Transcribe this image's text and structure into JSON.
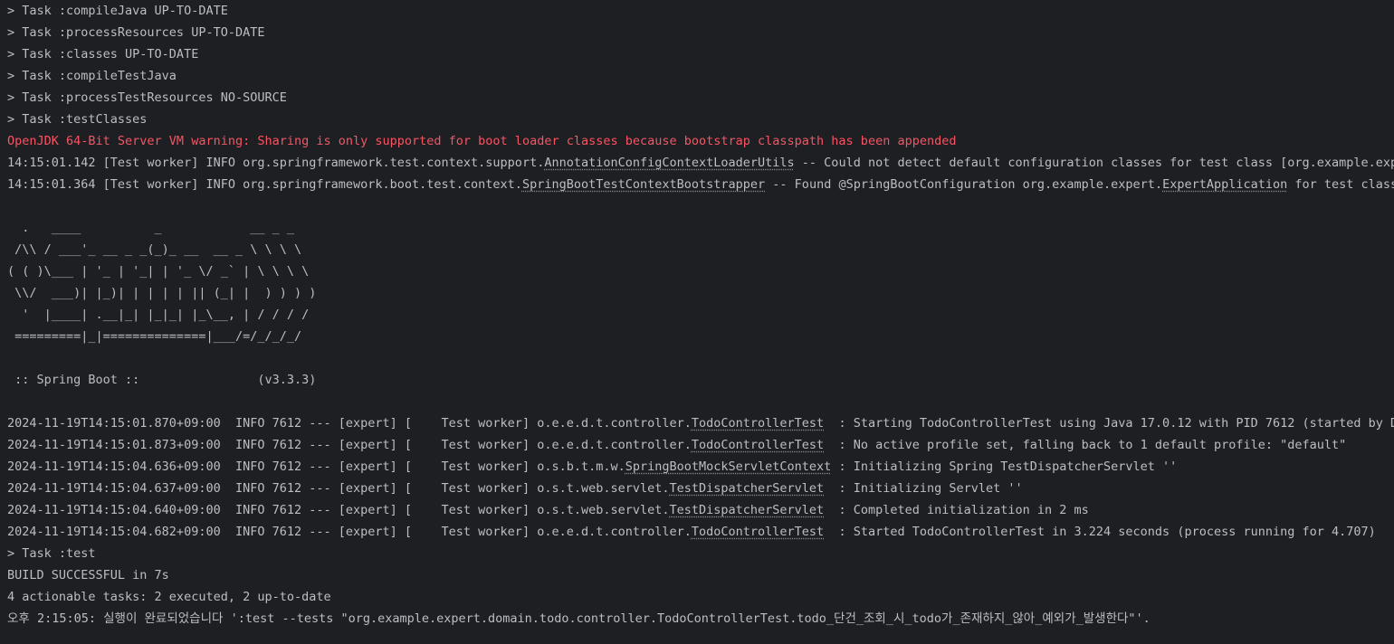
{
  "colors": {
    "background": "#1e1f22",
    "text": "#bcbec4",
    "warning": "#f75464"
  },
  "console": {
    "tasks": [
      "> Task :compileJava UP-TO-DATE",
      "> Task :processResources UP-TO-DATE",
      "> Task :classes UP-TO-DATE",
      "> Task :compileTestJava",
      "> Task :processTestResources NO-SOURCE",
      "> Task :testClasses"
    ],
    "warning": "OpenJDK 64-Bit Server VM warning: Sharing is only supported for boot loader classes because bootstrap classpath has been appended",
    "ctx1": {
      "pre": "14:15:01.142 [Test worker] INFO org.springframework.test.context.support.",
      "link": "AnnotationConfigContextLoaderUtils",
      "post": " -- Could not detect default configuration classes for test class [org.example.expert.domain.todo.controller.TodoControllerTest]"
    },
    "ctx2": {
      "pre": "14:15:01.364 [Test worker] INFO org.springframework.boot.test.context.",
      "link": "SpringBootTestContextBootstrapper",
      "mid": " -- Found @SpringBootConfiguration org.example.expert.",
      "link2": "ExpertApplication",
      "post": " for test class org.example.expert.domain.todo.controller.TodoControllerTest"
    },
    "banner": [
      "  .   ____          _            __ _ _",
      " /\\\\ / ___'_ __ _ _(_)_ __  __ _ \\ \\ \\ \\",
      "( ( )\\___ | '_ | '_| | '_ \\/ _` | \\ \\ \\ \\",
      " \\\\/  ___)| |_)| | | | | || (_| |  ) ) ) )",
      "  '  |____| .__|_| |_|_| |_\\__, | / / / /",
      " =========|_|==============|___/=/_/_/_/"
    ],
    "spring_boot": " :: Spring Boot ::                (v3.3.3)",
    "logs": [
      {
        "pre": "2024-11-19T14:15:01.870+09:00  INFO 7612 --- [expert] [    Test worker] o.e.e.d.t.controller.",
        "link": "TodoControllerTest",
        "post": "  : Starting TodoControllerTest using Java 17.0.12 with PID 7612 (started by DESKTOP in C:\\Users\\expert)"
      },
      {
        "pre": "2024-11-19T14:15:01.873+09:00  INFO 7612 --- [expert] [    Test worker] o.e.e.d.t.controller.",
        "link": "TodoControllerTest",
        "post": "  : No active profile set, falling back to 1 default profile: \"default\""
      },
      {
        "pre": "2024-11-19T14:15:04.636+09:00  INFO 7612 --- [expert] [    Test worker] o.s.b.t.m.w.",
        "link": "SpringBootMockServletContext",
        "post": " : Initializing Spring TestDispatcherServlet ''"
      },
      {
        "pre": "2024-11-19T14:15:04.637+09:00  INFO 7612 --- [expert] [    Test worker] o.s.t.web.servlet.",
        "link": "TestDispatcherServlet",
        "post": "  : Initializing Servlet ''"
      },
      {
        "pre": "2024-11-19T14:15:04.640+09:00  INFO 7612 --- [expert] [    Test worker] o.s.t.web.servlet.",
        "link": "TestDispatcherServlet",
        "post": "  : Completed initialization in 2 ms"
      },
      {
        "pre": "2024-11-19T14:15:04.682+09:00  INFO 7612 --- [expert] [    Test worker] o.e.e.d.t.controller.",
        "link": "TodoControllerTest",
        "post": "  : Started TodoControllerTest in 3.224 seconds (process running for 4.707)"
      }
    ],
    "task_test": "> Task :test",
    "build": "BUILD SUCCESSFUL in 7s",
    "actionable": "4 actionable tasks: 2 executed, 2 up-to-date",
    "completed": "오후 2:15:05: 실행이 완료되었습니다 ':test --tests \"org.example.expert.domain.todo.controller.TodoControllerTest.todo_단건_조회_시_todo가_존재하지_않아_예외가_발생한다\"'."
  }
}
